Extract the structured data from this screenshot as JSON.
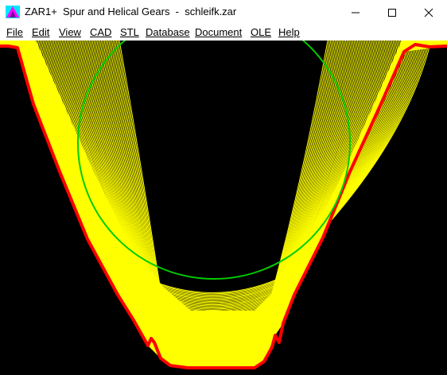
{
  "window": {
    "title": "ZAR1+  Spur and Helical Gears  -  schleifk.zar",
    "minimize_label": "minimize",
    "maximize_label": "maximize",
    "close_label": "close"
  },
  "menu": {
    "items": [
      {
        "label": "File"
      },
      {
        "label": "Edit"
      },
      {
        "label": "View"
      },
      {
        "label": "CAD"
      },
      {
        "label": "STL"
      },
      {
        "label": "Database"
      },
      {
        "label": "Document"
      },
      {
        "label": "OLE"
      },
      {
        "label": "Help"
      }
    ]
  },
  "drawing": {
    "background": "#000000",
    "tool_envelope_color": "#ffff00",
    "tool_outline_color": "#ff0000",
    "pitch_circle_color": "#00cc00"
  },
  "icons": {
    "app": "zar-app-icon",
    "minimize": "minimize-icon",
    "maximize": "maximize-icon",
    "close": "close-icon"
  }
}
